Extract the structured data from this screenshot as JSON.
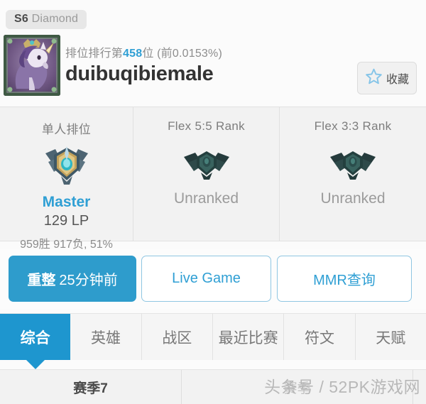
{
  "season_badge": {
    "prefix": "S6",
    "tier": "Diamond"
  },
  "header": {
    "avatar_icon": "summoner-avatar-unicorn",
    "rank_prefix": "排位排行第",
    "rank_number": "458",
    "rank_suffix": "位 (前0.0153%)",
    "summoner_name": "duibuqibiemale",
    "favorite_label": "收藏",
    "favorite_icon": "star-outline-icon",
    "accent_color": "#2f9fd4"
  },
  "ranks": [
    {
      "title": "单人排位",
      "emblem_icon": "master-rank-emblem",
      "tier": "Master",
      "lp": "129 LP",
      "record": "959胜 917负, 51%",
      "tier_color": "#2f9fd4"
    },
    {
      "title": "Flex 5:5 Rank",
      "emblem_icon": "unranked-emblem",
      "tier": "Unranked",
      "lp": "",
      "record": "",
      "tier_color": "#9b9b9b"
    },
    {
      "title": "Flex 3:3 Rank",
      "emblem_icon": "unranked-emblem",
      "tier": "Unranked",
      "lp": "",
      "record": "",
      "tier_color": "#9b9b9b"
    }
  ],
  "actions": {
    "refresh_label": "重整",
    "refresh_ago": "25分钟前",
    "live_game_label": "Live Game",
    "mmr_label": "MMR查询",
    "primary_color": "#2e9ccc",
    "outline_color": "#8fc6e2"
  },
  "tabs": [
    {
      "label": "综合",
      "active": true
    },
    {
      "label": "英雄",
      "active": false
    },
    {
      "label": "战区",
      "active": false
    },
    {
      "label": "最近比赛",
      "active": false
    },
    {
      "label": "符文",
      "active": false
    },
    {
      "label": "天赋",
      "active": false
    }
  ],
  "bottom": {
    "season_label": "赛季7",
    "secondary_label": "赛季"
  },
  "watermark": {
    "text": "头条号 / 52PK游戏网"
  }
}
